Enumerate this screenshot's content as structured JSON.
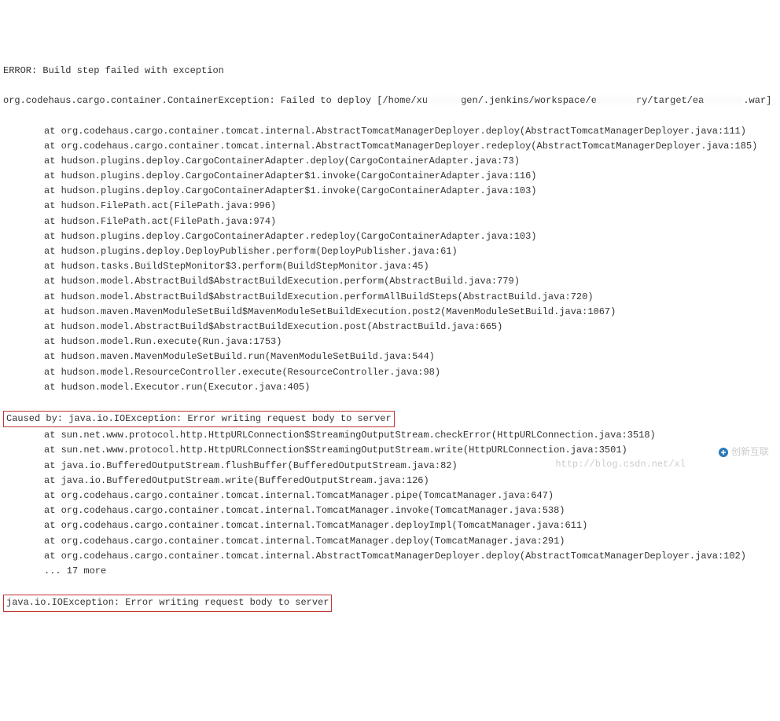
{
  "error_header": "ERROR: Build step failed with exception",
  "exception_line_pre": "org.codehaus.cargo.container.ContainerException: Failed to deploy [/home/xu",
  "exception_line_mid": "gen/.jenkins/workspace/e",
  "exception_line_mid2": "ry/target/ea",
  "exception_line_end": ".war]",
  "trace1": [
    "at org.codehaus.cargo.container.tomcat.internal.AbstractTomcatManagerDeployer.deploy(AbstractTomcatManagerDeployer.java:111)",
    "at org.codehaus.cargo.container.tomcat.internal.AbstractTomcatManagerDeployer.redeploy(AbstractTomcatManagerDeployer.java:185)",
    "at hudson.plugins.deploy.CargoContainerAdapter.deploy(CargoContainerAdapter.java:73)",
    "at hudson.plugins.deploy.CargoContainerAdapter$1.invoke(CargoContainerAdapter.java:116)",
    "at hudson.plugins.deploy.CargoContainerAdapter$1.invoke(CargoContainerAdapter.java:103)",
    "at hudson.FilePath.act(FilePath.java:996)",
    "at hudson.FilePath.act(FilePath.java:974)",
    "at hudson.plugins.deploy.CargoContainerAdapter.redeploy(CargoContainerAdapter.java:103)",
    "at hudson.plugins.deploy.DeployPublisher.perform(DeployPublisher.java:61)",
    "at hudson.tasks.BuildStepMonitor$3.perform(BuildStepMonitor.java:45)",
    "at hudson.model.AbstractBuild$AbstractBuildExecution.perform(AbstractBuild.java:779)",
    "at hudson.model.AbstractBuild$AbstractBuildExecution.performAllBuildSteps(AbstractBuild.java:720)",
    "at hudson.maven.MavenModuleSetBuild$MavenModuleSetBuildExecution.post2(MavenModuleSetBuild.java:1067)",
    "at hudson.model.AbstractBuild$AbstractBuildExecution.post(AbstractBuild.java:665)",
    "at hudson.model.Run.execute(Run.java:1753)",
    "at hudson.maven.MavenModuleSetBuild.run(MavenModuleSetBuild.java:544)",
    "at hudson.model.ResourceController.execute(ResourceController.java:98)",
    "at hudson.model.Executor.run(Executor.java:405)"
  ],
  "caused_by": "Caused by: java.io.IOException: Error writing request body to server",
  "trace2": [
    "at sun.net.www.protocol.http.HttpURLConnection$StreamingOutputStream.checkError(HttpURLConnection.java:3518)",
    "at sun.net.www.protocol.http.HttpURLConnection$StreamingOutputStream.write(HttpURLConnection.java:3501)",
    "at java.io.BufferedOutputStream.flushBuffer(BufferedOutputStream.java:82)",
    "at java.io.BufferedOutputStream.write(BufferedOutputStream.java:126)",
    "at org.codehaus.cargo.container.tomcat.internal.TomcatManager.pipe(TomcatManager.java:647)",
    "at org.codehaus.cargo.container.tomcat.internal.TomcatManager.invoke(TomcatManager.java:538)",
    "at org.codehaus.cargo.container.tomcat.internal.TomcatManager.deployImpl(TomcatManager.java:611)",
    "at org.codehaus.cargo.container.tomcat.internal.TomcatManager.deploy(TomcatManager.java:291)",
    "at org.codehaus.cargo.container.tomcat.internal.AbstractTomcatManagerDeployer.deploy(AbstractTomcatManagerDeployer.java:102)",
    "... 17 more"
  ],
  "secondary_exception": "java.io.IOException: Error writing request body to server",
  "watermark_brand": "创新互联",
  "watermark_url": "http://blog.csdn.net/xl"
}
